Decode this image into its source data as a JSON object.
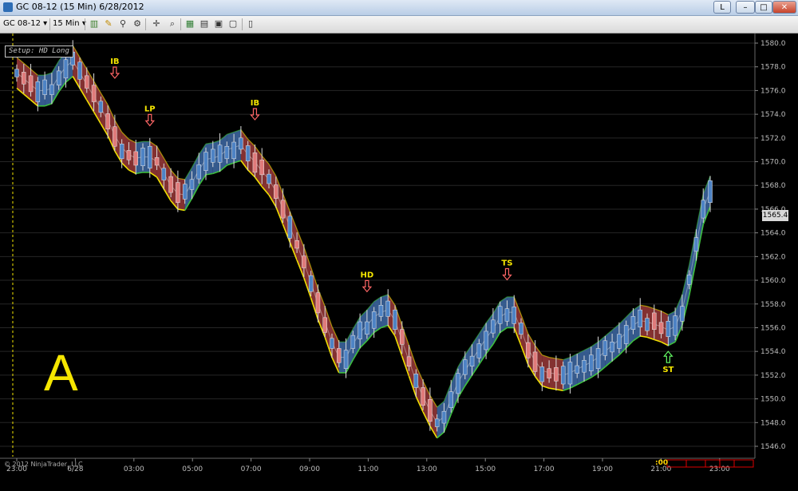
{
  "window": {
    "title": "GC 08-12 (15 Min)  6/28/2012",
    "buttons": {
      "link": "L",
      "minimize": "–",
      "maximize": "□",
      "close": "✕"
    }
  },
  "toolbar": {
    "instrument": "GC 08-12",
    "interval": "15 Min"
  },
  "chart": {
    "setup_label": "Setup: HD Long",
    "watermark": "A",
    "copyright": "© 2012 NinjaTrader, LLC",
    "last_price": "1565.4",
    "bar_timer": ":00",
    "colors": {
      "up": "#4e83c5",
      "down": "#e07b7b",
      "band_up": "#3e6aa6",
      "band_down": "#9a3a3a",
      "signal": "#f5e600",
      "axis_text": "#bdbdbd"
    }
  },
  "chart_data": {
    "type": "candlestick",
    "instrument": "GC 08-12",
    "interval": "15 Min",
    "date": "6/28/2012",
    "ylim": [
      1545,
      1581
    ],
    "y_ticks": [
      "1546.0",
      "1548.0",
      "1550.0",
      "1552.0",
      "1554.0",
      "1556.0",
      "1558.0",
      "1560.0",
      "1562.0",
      "1564.0",
      "1566.0",
      "1568.0",
      "1570.0",
      "1572.0",
      "1574.0",
      "1576.0",
      "1578.0",
      "1580.0"
    ],
    "x_ticks": [
      "23:00",
      "6/28",
      "03:00",
      "05:00",
      "07:00",
      "09:00",
      "11:00",
      "13:00",
      "15:00",
      "17:00",
      "19:00",
      "21:00",
      "23:00"
    ],
    "signals": [
      {
        "label": "IB",
        "time": "02:45",
        "price": 1576.5,
        "direction": "down"
      },
      {
        "label": "LP",
        "time": "04:00",
        "price": 1572.5,
        "direction": "down"
      },
      {
        "label": "IB",
        "time": "07:45",
        "price": 1573.0,
        "direction": "down"
      },
      {
        "label": "HD",
        "time": "11:30",
        "price": 1558.5,
        "direction": "down"
      },
      {
        "label": "TS",
        "time": "15:30",
        "price": 1559.5,
        "direction": "down"
      },
      {
        "label": "ST",
        "time": "22:00",
        "price": 1554.0,
        "direction": "up"
      }
    ]
  }
}
